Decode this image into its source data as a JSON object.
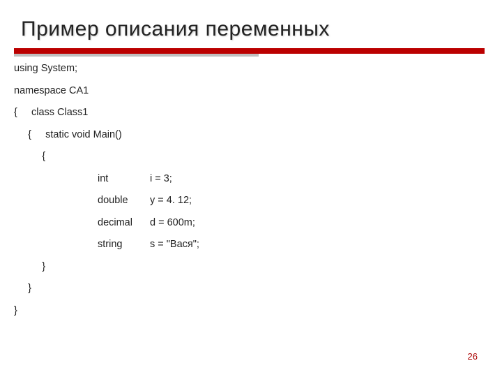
{
  "title": "Пример описания переменных",
  "code": {
    "l1": "using System;",
    "l2": "namespace CA1",
    "l3": "{     class Class1",
    "l4": "     {     static void Main()",
    "l5": "          {",
    "d1k": "int",
    "d1v": "i = 3;",
    "d2k": "double",
    "d2v": "y = 4. 12;",
    "d3k": "decimal",
    "d3v": "d = 600m;",
    "d4k": "string",
    "d4v": "s = \"Вася\";",
    "l10": "          }",
    "l11": "     }",
    "l12": "}"
  },
  "page": "26"
}
